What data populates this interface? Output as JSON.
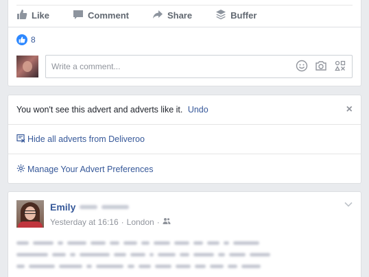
{
  "post_actions": {
    "like": "Like",
    "comment": "Comment",
    "share": "Share",
    "buffer": "Buffer"
  },
  "reactions": {
    "count": "8"
  },
  "comment_box": {
    "placeholder": "Write a comment..."
  },
  "ad_hidden": {
    "message": "You won't see this advert and adverts like it.",
    "undo": "Undo",
    "close": "×",
    "hide_all": "Hide all adverts from Deliveroo",
    "manage": "Manage Your Advert Preferences"
  },
  "post": {
    "author": "Emily",
    "timestamp": "Yesterday at 16:16",
    "separator": "·",
    "location": "London"
  },
  "colors": {
    "link": "#365899",
    "muted": "#90949c",
    "action": "#606770",
    "like_blue": "#2d88ff",
    "page_bg": "#e9ebee"
  }
}
